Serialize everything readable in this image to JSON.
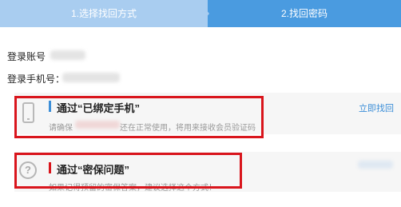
{
  "steps": [
    {
      "label": "1.选择找回方式"
    },
    {
      "label": "2.找回密码"
    }
  ],
  "account": {
    "username_label": "登录账号",
    "phone_label": "登录手机号："
  },
  "options": [
    {
      "title": "通过“已绑定手机”",
      "desc_prefix": "请确保",
      "desc_suffix": "还在正常使用，将用来接收会员验证码",
      "action": "立即找回",
      "icon": "mobile-phone-icon"
    },
    {
      "title": "通过“密保问题”",
      "desc": "如果记得预留的密保答案，建议选择这个方式！",
      "icon": "question-mark-icon"
    }
  ],
  "colors": {
    "step_inactive": "#a9cdf0",
    "step_active": "#4a9be0",
    "highlight_box": "#d9151c",
    "link": "#3d8fd8"
  }
}
